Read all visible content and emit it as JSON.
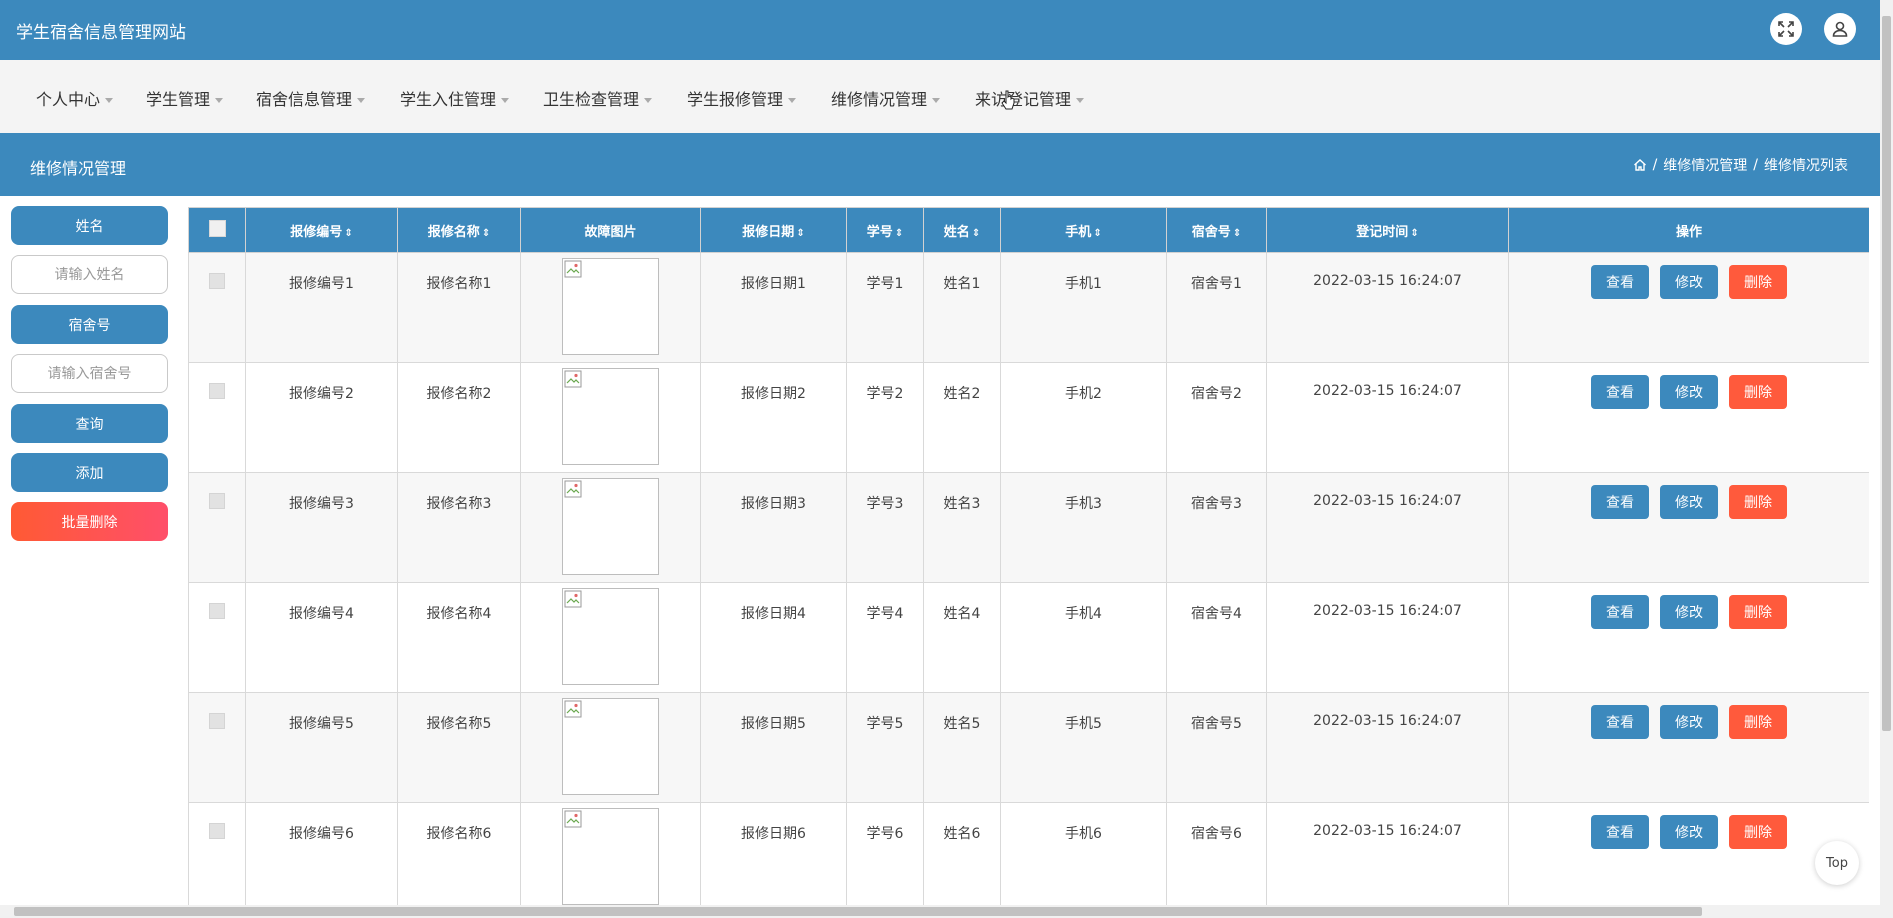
{
  "header": {
    "site_title": "学生宿舍信息管理网站",
    "icons": [
      "fullscreen-icon",
      "user-icon"
    ]
  },
  "menu": [
    {
      "label": "个人中心"
    },
    {
      "label": "学生管理"
    },
    {
      "label": "宿舍信息管理"
    },
    {
      "label": "学生入住管理"
    },
    {
      "label": "卫生检查管理"
    },
    {
      "label": "学生报修管理"
    },
    {
      "label": "维修情况管理"
    },
    {
      "label": "来访登记管理"
    }
  ],
  "section": {
    "title": "维修情况管理",
    "breadcrumb": [
      "维修情况管理",
      "维修情况列表"
    ],
    "breadcrumb_sep": "/"
  },
  "sidebar": {
    "name_label": "姓名",
    "name_placeholder": "请输入姓名",
    "dorm_label": "宿舍号",
    "dorm_placeholder": "请输入宿舍号",
    "search_label": "查询",
    "add_label": "添加",
    "batch_delete_label": "批量删除"
  },
  "table": {
    "columns": [
      "报修编号",
      "报修名称",
      "故障图片",
      "报修日期",
      "学号",
      "姓名",
      "手机",
      "宿舍号",
      "登记时间",
      "操作"
    ],
    "sortable": [
      true,
      true,
      false,
      true,
      true,
      true,
      true,
      true,
      true,
      false
    ],
    "rows": [
      {
        "no": "报修编号1",
        "name": "报修名称1",
        "date": "报修日期1",
        "sid": "学号1",
        "stu": "姓名1",
        "phone": "手机1",
        "dorm": "宿舍号1",
        "time": "2022-03-15 16:24:07"
      },
      {
        "no": "报修编号2",
        "name": "报修名称2",
        "date": "报修日期2",
        "sid": "学号2",
        "stu": "姓名2",
        "phone": "手机2",
        "dorm": "宿舍号2",
        "time": "2022-03-15 16:24:07"
      },
      {
        "no": "报修编号3",
        "name": "报修名称3",
        "date": "报修日期3",
        "sid": "学号3",
        "stu": "姓名3",
        "phone": "手机3",
        "dorm": "宿舍号3",
        "time": "2022-03-15 16:24:07"
      },
      {
        "no": "报修编号4",
        "name": "报修名称4",
        "date": "报修日期4",
        "sid": "学号4",
        "stu": "姓名4",
        "phone": "手机4",
        "dorm": "宿舍号4",
        "time": "2022-03-15 16:24:07"
      },
      {
        "no": "报修编号5",
        "name": "报修名称5",
        "date": "报修日期5",
        "sid": "学号5",
        "stu": "姓名5",
        "phone": "手机5",
        "dorm": "宿舍号5",
        "time": "2022-03-15 16:24:07"
      },
      {
        "no": "报修编号6",
        "name": "报修名称6",
        "date": "报修日期6",
        "sid": "学号6",
        "stu": "姓名6",
        "phone": "手机6",
        "dorm": "宿舍号6",
        "time": "2022-03-15 16:24:07"
      }
    ],
    "actions": {
      "view": "查看",
      "edit": "修改",
      "delete": "删除"
    }
  },
  "top_button": "Top",
  "colors": {
    "primary": "#3c89bd",
    "danger": "#ff5a3c",
    "menubar": "#f4f4f4"
  }
}
